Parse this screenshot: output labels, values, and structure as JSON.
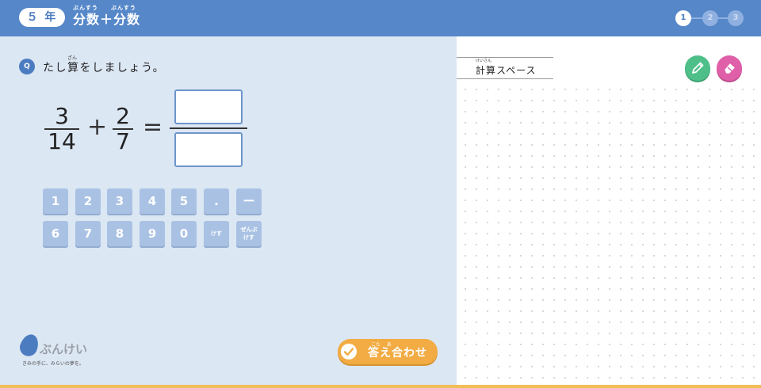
{
  "header": {
    "grade_label": "５ 年",
    "title_ruby_1": "ぶんすう",
    "title_ruby_2": "ぶんすう",
    "title": "分数＋分数",
    "steps": [
      "1",
      "2",
      "3"
    ],
    "active_step": 1
  },
  "question": {
    "badge": "Q",
    "ruby": "ざん",
    "text": "たし算をしましょう。"
  },
  "equation": {
    "a_num": "3",
    "a_den": "14",
    "plus": "+",
    "b_num": "2",
    "b_den": "7",
    "equals": "=",
    "answer_numerator_value": "",
    "answer_denominator_value": ""
  },
  "keypad": {
    "row1": [
      "1",
      "2",
      "3",
      "4",
      "5",
      ".",
      "ー"
    ],
    "row2": [
      "6",
      "7",
      "8",
      "9",
      "0"
    ],
    "erase_label": "けす",
    "erase_all_line1": "ぜんぶ",
    "erase_all_line2": "けす"
  },
  "logo": {
    "name": "ぶんけい",
    "tagline": "きみの手に、みらいの夢を。"
  },
  "check_button": {
    "ruby": "こた　 あ",
    "label": "答え合わせ"
  },
  "calc_space": {
    "ruby": "けいさん",
    "label": "計算スペース"
  },
  "colors": {
    "header": "#5587c9",
    "panel": "#dce7f4",
    "key": "#a9c2e4",
    "accent_orange": "#f2ac43",
    "pen_green": "#4fbf8a",
    "eraser_pink": "#df5fa9"
  },
  "icons": {
    "pen": "pencil-icon",
    "eraser": "eraser-icon",
    "check": "check-icon"
  }
}
